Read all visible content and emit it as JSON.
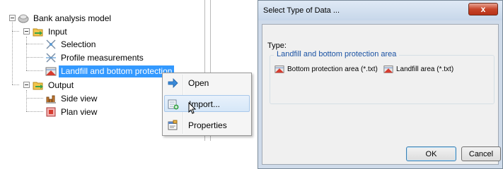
{
  "tree": {
    "root": {
      "label": "Bank analysis model",
      "icon": "globe-model-icon"
    },
    "input": {
      "label": "Input",
      "icon": "folder-input-icon"
    },
    "selection": {
      "label": "Selection",
      "icon": "selection-icon"
    },
    "profile": {
      "label": "Profile measurements",
      "icon": "profile-measurements-icon"
    },
    "landfill": {
      "label": "Landfill and bottom protection",
      "icon": "landfill-icon"
    },
    "output": {
      "label": "Output",
      "icon": "folder-output-icon"
    },
    "side_view": {
      "label": "Side view",
      "icon": "side-view-icon"
    },
    "plan_view": {
      "label": "Plan view",
      "icon": "plan-view-icon"
    }
  },
  "context_menu": {
    "items": [
      {
        "label": "Open",
        "icon": "arrow-right-icon"
      },
      {
        "label": "Import...",
        "icon": "import-icon",
        "hovered": true
      },
      {
        "label": "Properties",
        "icon": "properties-icon"
      }
    ]
  },
  "dialog": {
    "title": "Select Type of Data ...",
    "close_label": "x",
    "type_label": "Type:",
    "group_title": "Landfill and bottom protection area",
    "options": [
      {
        "label": "Bottom protection area (*.txt)",
        "icon": "bottom-protection-icon"
      },
      {
        "label": "Landfill area (*.txt)",
        "icon": "landfill-area-icon"
      }
    ],
    "ok_label": "OK",
    "cancel_label": "Cancel"
  },
  "colors": {
    "selection_bg": "#3399ff",
    "group_title": "#1a52a3",
    "close_button": "#c7452a"
  }
}
